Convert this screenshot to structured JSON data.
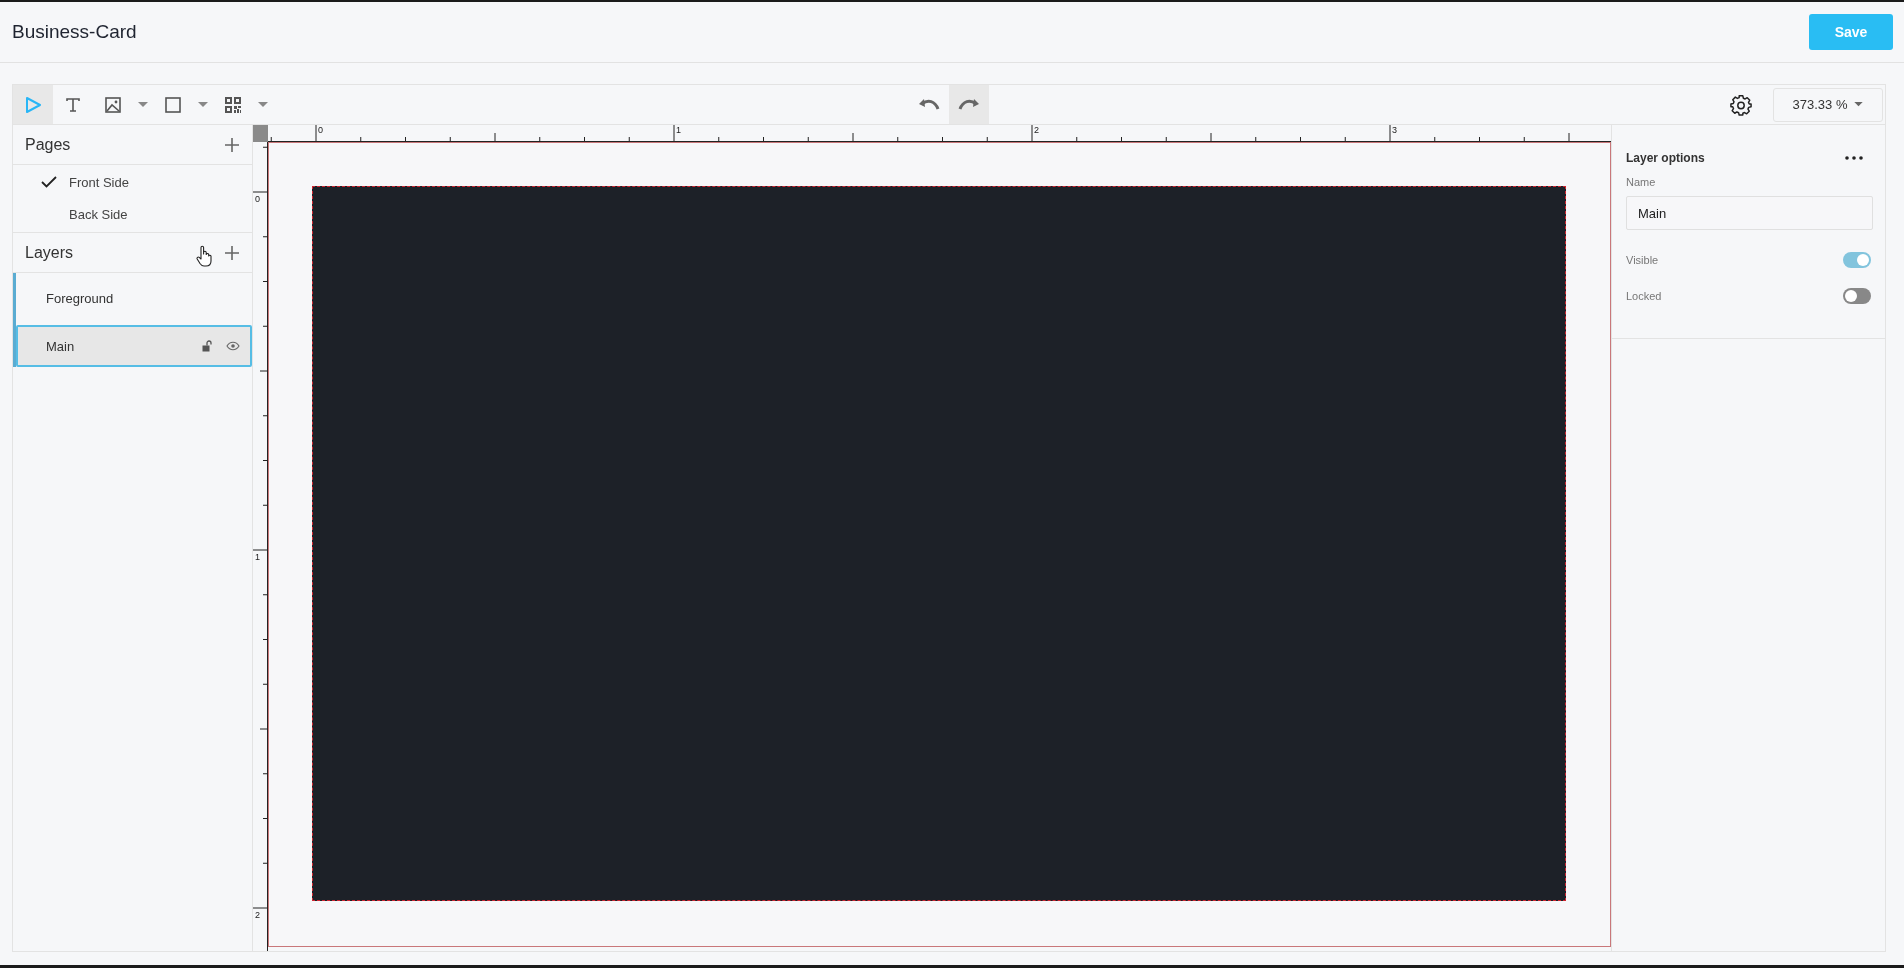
{
  "title": "Business-Card",
  "save_button": "Save",
  "toolbar": {
    "tools": [
      {
        "kind": "select",
        "selected": true,
        "dropdown": false
      },
      {
        "kind": "text",
        "selected": false,
        "dropdown": false
      },
      {
        "kind": "image",
        "selected": false,
        "dropdown": true
      },
      {
        "kind": "shape",
        "selected": false,
        "dropdown": true
      },
      {
        "kind": "qrcode",
        "selected": false,
        "dropdown": true
      }
    ],
    "history": [
      {
        "kind": "undo",
        "highlighted": false
      },
      {
        "kind": "redo",
        "highlighted": true
      }
    ],
    "zoom": "373.33 %"
  },
  "pages": {
    "title": "Pages",
    "items": [
      {
        "label": "Front Side",
        "selected": true
      },
      {
        "label": "Back Side",
        "selected": false
      }
    ]
  },
  "layers": {
    "title": "Layers",
    "items": [
      {
        "name": "Foreground",
        "selected": false
      },
      {
        "name": "Main",
        "selected": true,
        "locked": false,
        "visible": true
      }
    ]
  },
  "rulers": {
    "horizontal": [
      "0",
      "1",
      "2",
      "3"
    ],
    "vertical": [
      "0",
      "1",
      "2"
    ]
  },
  "layer_options": {
    "title": "Layer options",
    "name_label": "Name",
    "name_value": "Main",
    "toggles": [
      {
        "label": "Visible",
        "on": true
      },
      {
        "label": "Locked",
        "on": false
      }
    ]
  }
}
